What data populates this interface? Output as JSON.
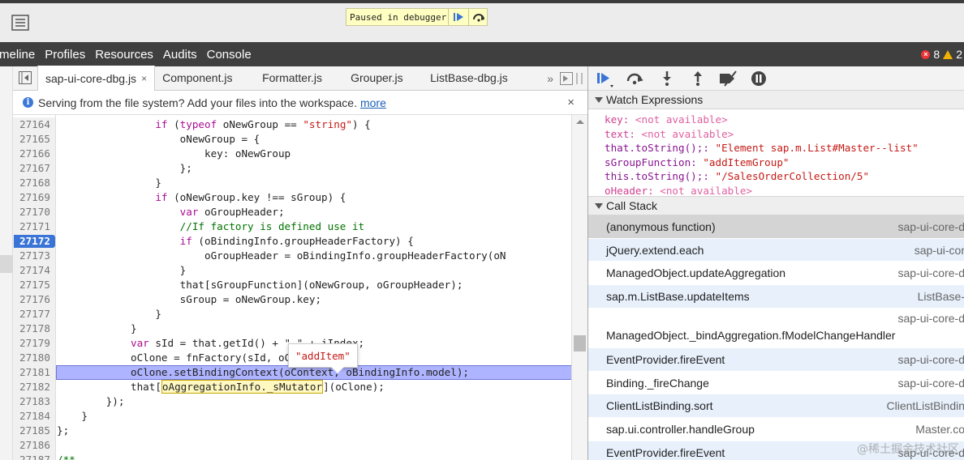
{
  "paused_banner": {
    "text": "Paused in debugger"
  },
  "nav": {
    "items": [
      "meline",
      "Profiles",
      "Resources",
      "Audits",
      "Console"
    ],
    "error_count": "8",
    "warning_count": "2"
  },
  "file_tabs": {
    "tabs": [
      "sap-ui-core-dbg.js",
      "Component.js",
      "Formatter.js",
      "Grouper.js",
      "ListBase-dbg.js"
    ],
    "active_close": "×",
    "overflow": "»"
  },
  "infobar": {
    "message": "Serving from the file system? Add your files into the workspace.",
    "link": "more",
    "close": "×"
  },
  "code": {
    "lines": [
      {
        "num": "27164",
        "ind": "                ",
        "parts": [
          [
            "kw",
            "if"
          ],
          [
            "t",
            " ("
          ],
          [
            "kw",
            "typeof"
          ],
          [
            "t",
            " oNewGroup == "
          ],
          [
            "str",
            "\"string\""
          ],
          [
            "t",
            ") {"
          ]
        ]
      },
      {
        "num": "27165",
        "ind": "                    ",
        "parts": [
          [
            "t",
            "oNewGroup = {"
          ]
        ]
      },
      {
        "num": "27166",
        "ind": "                        ",
        "parts": [
          [
            "t",
            "key: oNewGroup"
          ]
        ]
      },
      {
        "num": "27167",
        "ind": "                    ",
        "parts": [
          [
            "t",
            "};"
          ]
        ]
      },
      {
        "num": "27168",
        "ind": "                ",
        "parts": [
          [
            "t",
            "}"
          ]
        ]
      },
      {
        "num": "27169",
        "ind": "                ",
        "parts": [
          [
            "kw",
            "if"
          ],
          [
            "t",
            " (oNewGroup.key !== sGroup) {"
          ]
        ]
      },
      {
        "num": "27170",
        "ind": "                    ",
        "parts": [
          [
            "kw",
            "var"
          ],
          [
            "t",
            " oGroupHeader;"
          ]
        ]
      },
      {
        "num": "27171",
        "ind": "                    ",
        "parts": [
          [
            "cm",
            "//If factory is defined use it"
          ]
        ]
      },
      {
        "num": "27172",
        "ind": "                    ",
        "parts": [
          [
            "kw",
            "if"
          ],
          [
            "t",
            " (oBindingInfo.groupHeaderFactory) {"
          ]
        ]
      },
      {
        "num": "27173",
        "ind": "                        ",
        "parts": [
          [
            "t",
            "oGroupHeader = oBindingInfo.groupHeaderFactory(oN"
          ]
        ]
      },
      {
        "num": "27174",
        "ind": "                    ",
        "parts": [
          [
            "t",
            "}"
          ]
        ]
      },
      {
        "num": "27175",
        "ind": "                    ",
        "parts": [
          [
            "t",
            "that[sGroupFunction](oNewGroup, oGroupHeader);"
          ]
        ]
      },
      {
        "num": "27176",
        "ind": "                    ",
        "parts": [
          [
            "t",
            "sGroup = oNewGroup.key;"
          ]
        ]
      },
      {
        "num": "27177",
        "ind": "                ",
        "parts": [
          [
            "t",
            "}"
          ]
        ]
      },
      {
        "num": "27178",
        "ind": "            ",
        "parts": [
          [
            "t",
            "}"
          ]
        ]
      },
      {
        "num": "27179",
        "ind": "            ",
        "parts": [
          [
            "kw",
            "var"
          ],
          [
            "t",
            " sId = that.getId() + \"-\" + iIndex;"
          ]
        ]
      },
      {
        "num": "27180",
        "ind": "            ",
        "parts": [
          [
            "t",
            "oClone = fnFactory(sId, oContext);"
          ]
        ]
      },
      {
        "num": "27181",
        "ind": "            ",
        "parts": [
          [
            "t",
            "oClone.setBindingContext(oContext, oBindingInfo.model);"
          ]
        ]
      },
      {
        "num": "27182",
        "ind": "            ",
        "parts": [
          [
            "t",
            "that["
          ],
          [
            "hl",
            "oAggregationInfo._sMutator"
          ],
          [
            "t",
            "](oClone);"
          ]
        ]
      },
      {
        "num": "27183",
        "ind": "        ",
        "parts": [
          [
            "t",
            "});"
          ]
        ]
      },
      {
        "num": "27184",
        "ind": "    ",
        "parts": [
          [
            "t",
            "}"
          ]
        ]
      },
      {
        "num": "27185",
        "ind": "",
        "parts": [
          [
            "t",
            "};"
          ]
        ]
      },
      {
        "num": "27186",
        "ind": "",
        "parts": [
          [
            "t",
            ""
          ]
        ]
      },
      {
        "num": "27187",
        "ind": "",
        "parts": [
          [
            "cm",
            "/**"
          ]
        ]
      }
    ],
    "breakpoint_line": "27172",
    "execution_line": "27181",
    "tooltip": "\"addItem\""
  },
  "watch": {
    "title": "Watch Expressions",
    "rows": [
      {
        "name": "key",
        "value": "<not available>",
        "available": false
      },
      {
        "name": "text",
        "value": "<not available>",
        "available": false
      },
      {
        "name": "that.toString();",
        "value": "\"Element sap.m.List#Master--list\"",
        "available": true
      },
      {
        "name": "sGroupFunction",
        "value": "\"addItemGroup\"",
        "available": true
      },
      {
        "name": "this.toString();",
        "value": "\"/SalesOrderCollection/5\"",
        "available": true
      },
      {
        "name": "oHeader",
        "value": "<not available>",
        "available": false
      }
    ]
  },
  "call_stack": {
    "title": "Call Stack",
    "rows": [
      {
        "fn": "(anonymous function)",
        "src": "sap-ui-core-d"
      },
      {
        "fn": "jQuery.extend.each",
        "src": "sap-ui-cor"
      },
      {
        "fn": "ManagedObject.updateAggregation",
        "src": "sap-ui-core-d"
      },
      {
        "fn": "sap.m.ListBase.updateItems",
        "src": "ListBase-"
      },
      {
        "fn": "ManagedObject._bindAggregation.fModelChangeHandler",
        "src": "sap-ui-core-d"
      },
      {
        "fn": "EventProvider.fireEvent",
        "src": "sap-ui-core-d"
      },
      {
        "fn": "Binding._fireChange",
        "src": "sap-ui-core-d"
      },
      {
        "fn": "ClientListBinding.sort",
        "src": "ClientListBindin"
      },
      {
        "fn": "sap.ui.controller.handleGroup",
        "src": "Master.co"
      },
      {
        "fn": "EventProvider.fireEvent",
        "src": "sap-ui-core-d"
      }
    ]
  },
  "watermark": "@稀土掘金技术社区",
  "colors": {
    "nav_bg": "#3f3f3f",
    "exec_line": "#aeb4ff",
    "breakpoint": "#3a74d7",
    "banner_bg": "#ffffc2",
    "stack_alt": "#e7f0fb"
  }
}
